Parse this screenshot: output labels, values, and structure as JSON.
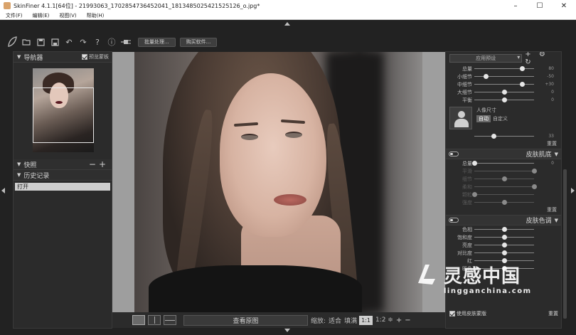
{
  "window": {
    "title": "SkinFiner 4.1.1[64位] - 21993063_1702854736452041_1813485025421525126_o.jpg*",
    "controls": [
      "–",
      "☐",
      "✕"
    ]
  },
  "menu": {
    "items": [
      "文件(F)",
      "编辑(E)",
      "视图(V)",
      "帮助(H)"
    ]
  },
  "toolbar": {
    "icons": [
      "leaf-icon",
      "folder-open-icon",
      "save-icon",
      "save-as-icon",
      "undo-icon",
      "redo-icon",
      "help-icon",
      "info-icon",
      "plug-icon"
    ],
    "batch_label": "批量处理...",
    "buy_label": "购买软件..."
  },
  "navigator": {
    "title": "导航器",
    "checkbox_label": "预览蒙板"
  },
  "snapshots": {
    "title": "快照",
    "buttons": "−+"
  },
  "history": {
    "title": "历史记录",
    "items": [
      "打开"
    ]
  },
  "bottom_bar": {
    "view_original": "查看原图",
    "zoom_label": "缩放:",
    "fit_label": "适合",
    "fill_label": "填满",
    "zoom_1_1": "1:1",
    "zoom_1_2": "1:2 ≑",
    "plus": "+",
    "minus": "−"
  },
  "right": {
    "preset": "应用预设",
    "preset_icons": "+ ⚙ ↻",
    "smooth_sliders": [
      {
        "label": "总量",
        "value": 0.8,
        "val_text": "80"
      },
      {
        "label": "小细节",
        "value": 0.2,
        "val_text": "-50"
      },
      {
        "label": "中细节",
        "value": 0.8,
        "val_text": "+30"
      },
      {
        "label": "大细节",
        "value": 0.5,
        "val_text": "0"
      },
      {
        "label": "平衡",
        "value": 0.5,
        "val_text": "0"
      }
    ],
    "portrait_caption": "人像尺寸",
    "auto_label": "自动",
    "custom_label": "自定义",
    "portrait_value_text": "33",
    "portrait_value": 0.33,
    "reset_label": "重置",
    "skin_texture": {
      "title": "皮肤肌底",
      "sliders": [
        {
          "label": "总量",
          "value": 0.0,
          "val_text": "0",
          "dim": false
        },
        {
          "label": "平滑",
          "value": 1.0,
          "val_text": "",
          "dim": true
        },
        {
          "label": "细节",
          "value": 0.5,
          "val_text": "",
          "dim": true
        },
        {
          "label": "柔和",
          "value": 1.0,
          "val_text": "",
          "dim": true
        },
        {
          "label": "颗粒",
          "value": 0.0,
          "val_text": "",
          "dim": true
        },
        {
          "label": "强度",
          "value": 0.5,
          "val_text": "",
          "dim": true
        }
      ],
      "reset_label": "重置"
    },
    "skin_tone": {
      "title": "皮肤色调",
      "sliders": [
        {
          "label": "色相",
          "value": 0.5,
          "val_text": "",
          "dim": false
        },
        {
          "label": "饱和度",
          "value": 0.5,
          "val_text": "",
          "dim": false
        },
        {
          "label": "亮度",
          "value": 0.5,
          "val_text": "",
          "dim": false
        },
        {
          "label": "对比度",
          "value": 0.5,
          "val_text": "",
          "dim": false
        },
        {
          "label": "红",
          "value": 0.5,
          "val_text": "",
          "dim": false
        },
        {
          "label": "暖色",
          "value": 0.5,
          "val_text": "",
          "dim": false
        }
      ]
    },
    "skin_mask_label": "使用皮肤蒙版",
    "skin_mask_reset": "重置"
  },
  "watermark": {
    "cn": "灵感中国",
    "en": "lingganchina.com"
  }
}
